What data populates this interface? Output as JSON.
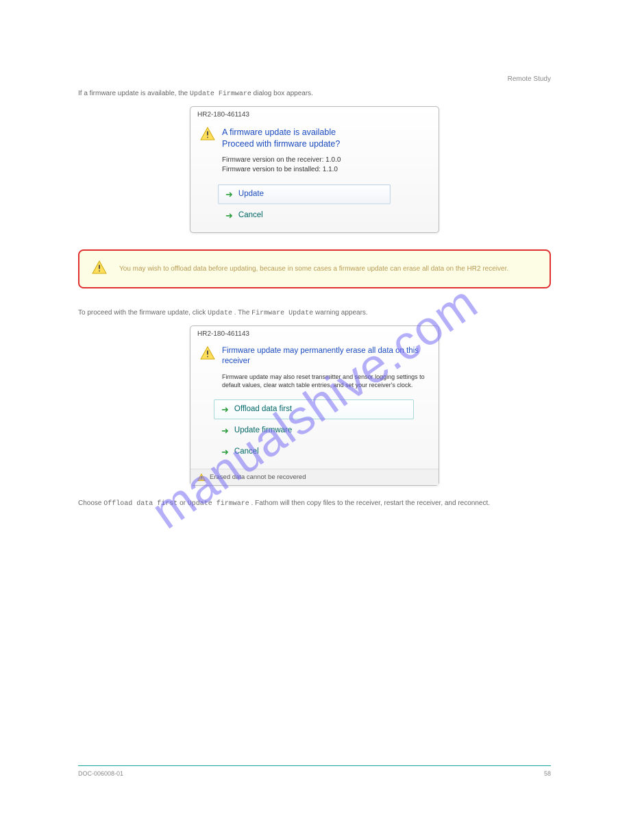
{
  "header_right": "Remote Study",
  "intro": {
    "p1_a": "If a firmware update is available, the ",
    "p1_b": "Update Firmware",
    "p1_c": " dialog box appears."
  },
  "dialog1": {
    "title": "HR2-180-461143",
    "headline1": "A firmware update is available",
    "headline2": "Proceed with firmware update?",
    "line1": "Firmware version on the receiver: 1.0.0",
    "line2": "Firmware version to be installed: 1.1.0",
    "actions": {
      "update": "Update",
      "cancel": "Cancel"
    }
  },
  "callout": {
    "text": "You may wish to offload data before updating, because in some cases a firmware update can erase all data on the HR2 receiver."
  },
  "mid": {
    "p2_a": "To proceed with the firmware update, click ",
    "p2_b": "Update",
    "p2_c": ". The ",
    "p2_d": "Firmware Update",
    "p2_e": " warning appears."
  },
  "dialog2": {
    "title": "HR2-180-461143",
    "headline": "Firmware update may permanently erase all data on this receiver",
    "sub": "Firmware update may also reset transmitter and sensor logging settings to default values, clear watch table entries, and set your receiver's clock.",
    "actions": {
      "offload": "Offload data first",
      "update": "Update firmware",
      "cancel": "Cancel"
    },
    "footer": "Erased data cannot be recovered"
  },
  "closing_a": "Choose ",
  "closing_b": "Offload data first",
  "closing_c": " or ",
  "closing_d": "Update firmware",
  "closing_e": ". Fathom will then copy files to the receiver, restart the receiver, and reconnect.",
  "watermark": "manualshive.com",
  "footer_left": "DOC-006008-01",
  "footer_right": "58"
}
